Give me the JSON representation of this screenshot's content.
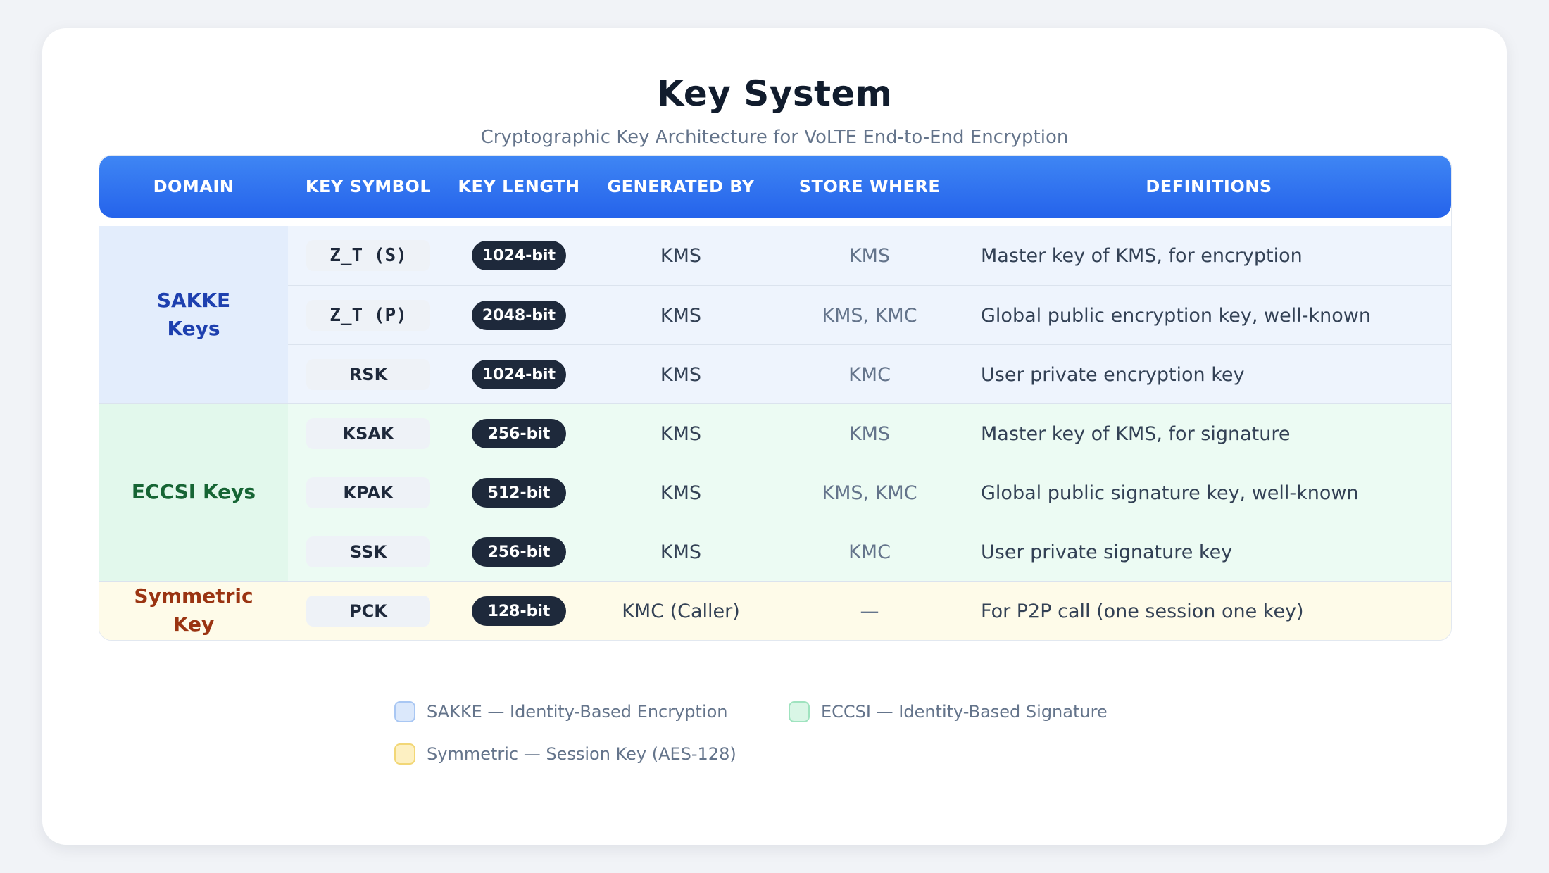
{
  "header": {
    "title": "Key System",
    "subtitle": "Cryptographic Key Architecture for VoLTE End-to-End Encryption"
  },
  "table": {
    "columns": [
      "DOMAIN",
      "KEY SYMBOL",
      "KEY LENGTH",
      "GENERATED BY",
      "STORE WHERE",
      "DEFINITIONS"
    ],
    "domains": [
      {
        "label": "SAKKE Keys",
        "text_color": "#1e40af",
        "bg": "#e3edfc",
        "row_bg": "#eef4fd"
      },
      {
        "label": "ECCSI Keys",
        "text_color": "#166534",
        "bg": "#e2f8ec",
        "row_bg": "#ecfbf3"
      },
      {
        "label": "Symmetric Key",
        "text_color": "#9a3412",
        "bg": "#fefbe9",
        "row_bg": "#fefbe9"
      }
    ],
    "rows": [
      {
        "symbol": "Z_T (S)",
        "length": "1024-bit",
        "generated_by": "KMS",
        "store_where": "KMS",
        "definition": "Master key of KMS, for encryption"
      },
      {
        "symbol": "Z_T (P)",
        "length": "2048-bit",
        "generated_by": "KMS",
        "store_where": "KMS, KMC",
        "definition": "Global public encryption key, well-known"
      },
      {
        "symbol": "RSK",
        "length": "1024-bit",
        "generated_by": "KMS",
        "store_where": "KMC",
        "definition": "User private encryption key"
      },
      {
        "symbol": "KSAK",
        "length": "256-bit",
        "generated_by": "KMS",
        "store_where": "KMS",
        "definition": "Master key of KMS, for signature"
      },
      {
        "symbol": "KPAK",
        "length": "512-bit",
        "generated_by": "KMS",
        "store_where": "KMS, KMC",
        "definition": "Global public signature key, well-known"
      },
      {
        "symbol": "SSK",
        "length": "256-bit",
        "generated_by": "KMS",
        "store_where": "KMC",
        "definition": "User private signature key"
      },
      {
        "symbol": "PCK",
        "length": "128-bit",
        "generated_by": "KMC (Caller)",
        "store_where": "—",
        "definition": "For P2P call (one session one key)"
      }
    ]
  },
  "legend": [
    {
      "label": "SAKKE — Identity-Based Encryption",
      "fill": "#dbe8fb",
      "border": "#a9c7f3"
    },
    {
      "label": "ECCSI — Identity-Based Signature",
      "fill": "#d9f6e6",
      "border": "#9fe3bf"
    },
    {
      "label": "Symmetric — Session Key (AES-128)",
      "fill": "#fdf0c2",
      "border": "#f2d777"
    }
  ]
}
